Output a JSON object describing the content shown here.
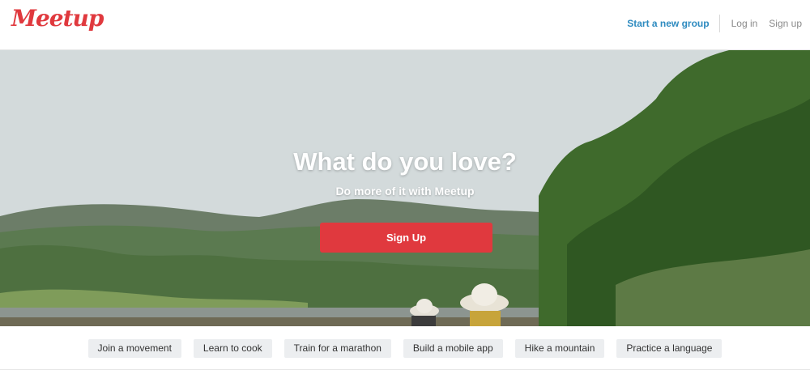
{
  "header": {
    "logo_text": "Meetup",
    "nav": {
      "start_group": "Start a new group",
      "login": "Log in",
      "signup": "Sign up"
    }
  },
  "hero": {
    "title": "What do you love?",
    "subtitle": "Do more of it with Meetup",
    "cta_label": "Sign Up"
  },
  "topics": [
    "Join a movement",
    "Learn to cook",
    "Train for a marathon",
    "Build a mobile app",
    "Hike a mountain",
    "Practice a language"
  ],
  "colors": {
    "brand_red": "#e0393e",
    "link_blue": "#2e8bc0",
    "chip_bg": "#eceef0"
  }
}
